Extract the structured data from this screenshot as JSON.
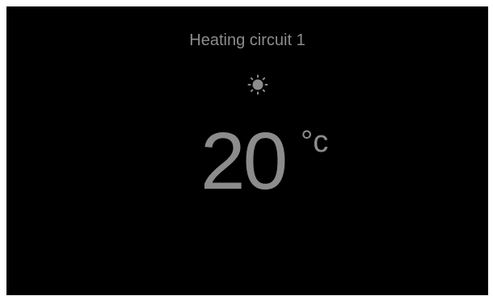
{
  "header": {
    "title": "Heating circuit 1"
  },
  "mode": {
    "icon": "sun-icon"
  },
  "temperature": {
    "value": "20",
    "unit": "°c"
  },
  "colors": {
    "background": "#000000",
    "text": "#8c8c8c"
  }
}
